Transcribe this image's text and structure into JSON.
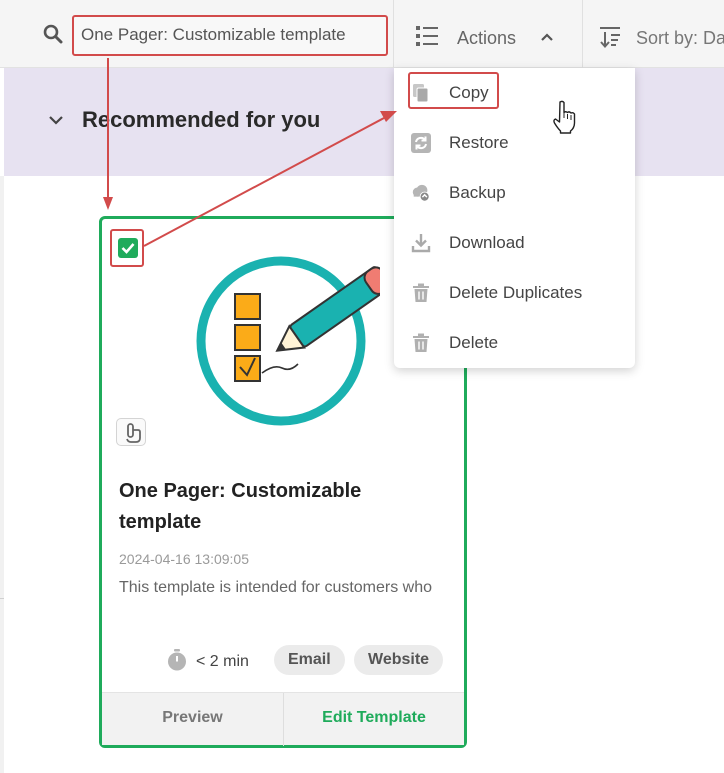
{
  "toolbar": {
    "search_value": "One Pager: Customizable template",
    "actions_label": "Actions",
    "sort_label": "Sort by: Da"
  },
  "section": {
    "title": "Recommended for you"
  },
  "card": {
    "title": "One Pager: Customizable template",
    "date": "2024-04-16 13:09:05",
    "description": "This template is intended for customers who",
    "time": "< 2 min",
    "tags": [
      "Email",
      "Website"
    ],
    "preview_label": "Preview",
    "edit_label": "Edit Template",
    "checked": true
  },
  "actions_menu": {
    "items": [
      {
        "label": "Copy",
        "icon": "copy-icon"
      },
      {
        "label": "Restore",
        "icon": "restore-icon"
      },
      {
        "label": "Backup",
        "icon": "cloud-backup-icon"
      },
      {
        "label": "Download",
        "icon": "download-icon"
      },
      {
        "label": "Delete Duplicates",
        "icon": "trash-icon"
      },
      {
        "label": "Delete",
        "icon": "trash-icon"
      }
    ]
  },
  "colors": {
    "accent_green": "#1fab5b",
    "annotation_red": "#d24b4b",
    "section_band": "#e7e2f1",
    "illustration_teal": "#1ab2b0",
    "illustration_orange": "#fbab18"
  }
}
